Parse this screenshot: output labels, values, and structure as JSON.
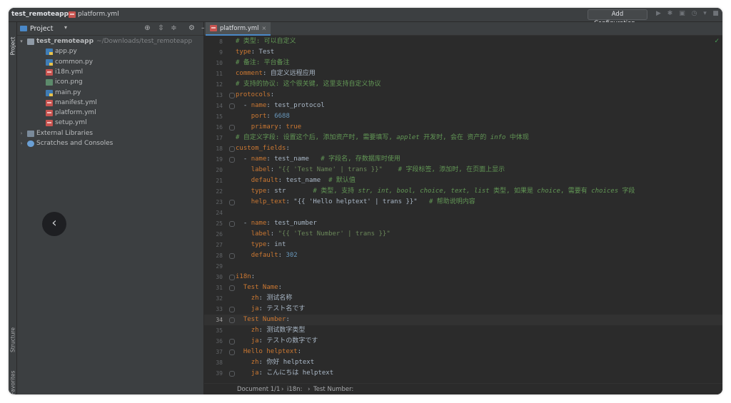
{
  "titlebar": {
    "project": "test_remoteapp",
    "file": "platform.yml",
    "run_config": "Add Configuration..."
  },
  "toolstrip": {
    "project": "Project",
    "structure": "Structure",
    "favorites": "Favorites"
  },
  "panel": {
    "title": "Project",
    "tree": [
      {
        "label": "test_remoteapp",
        "hint": "~/Downloads/test_remoteapp",
        "icon": "folder",
        "depth": 0,
        "arrow": "▾"
      },
      {
        "label": "app.py",
        "hint": "",
        "icon": "py",
        "depth": 2,
        "arrow": ""
      },
      {
        "label": "common.py",
        "hint": "",
        "icon": "py",
        "depth": 2,
        "arrow": ""
      },
      {
        "label": "i18n.yml",
        "hint": "",
        "icon": "yml",
        "depth": 2,
        "arrow": ""
      },
      {
        "label": "icon.png",
        "hint": "",
        "icon": "png",
        "depth": 2,
        "arrow": ""
      },
      {
        "label": "main.py",
        "hint": "",
        "icon": "py",
        "depth": 2,
        "arrow": ""
      },
      {
        "label": "manifest.yml",
        "hint": "",
        "icon": "yml",
        "depth": 2,
        "arrow": ""
      },
      {
        "label": "platform.yml",
        "hint": "",
        "icon": "yml",
        "depth": 2,
        "arrow": ""
      },
      {
        "label": "setup.yml",
        "hint": "",
        "icon": "yml",
        "depth": 2,
        "arrow": ""
      },
      {
        "label": "External Libraries",
        "hint": "",
        "icon": "lib",
        "depth": 0,
        "arrow": "›"
      },
      {
        "label": "Scratches and Consoles",
        "hint": "",
        "icon": "scratch",
        "depth": 0,
        "arrow": "›"
      }
    ]
  },
  "back_button": "‹",
  "editor": {
    "tab": "platform.yml",
    "current_line": 34,
    "lines": [
      {
        "n": 8,
        "t": [
          [
            "c",
            "# 类型: 可以自定义"
          ]
        ]
      },
      {
        "n": 9,
        "t": [
          [
            "k",
            "type"
          ],
          [
            "v",
            ": Test"
          ]
        ]
      },
      {
        "n": 10,
        "t": [
          [
            "c",
            "# 备注: 平台备注"
          ]
        ]
      },
      {
        "n": 11,
        "t": [
          [
            "k",
            "comment"
          ],
          [
            "v",
            ": 自定义远程应用"
          ]
        ]
      },
      {
        "n": 12,
        "t": [
          [
            "c",
            "# 支持的协议: 这个很关键, 这里支持自定义协议"
          ]
        ]
      },
      {
        "n": 13,
        "t": [
          [
            "k",
            "protocols"
          ],
          [
            "v",
            ":"
          ]
        ]
      },
      {
        "n": 14,
        "t": [
          [
            "v",
            "  - "
          ],
          [
            "k",
            "name"
          ],
          [
            "v",
            ": test_protocol"
          ]
        ]
      },
      {
        "n": 15,
        "t": [
          [
            "v",
            "    "
          ],
          [
            "k",
            "port"
          ],
          [
            "v",
            ": "
          ],
          [
            "n",
            "6688"
          ]
        ]
      },
      {
        "n": 16,
        "t": [
          [
            "v",
            "    "
          ],
          [
            "k",
            "primary"
          ],
          [
            "v",
            ": "
          ],
          [
            "k",
            "true"
          ]
        ]
      },
      {
        "n": 17,
        "t": [
          [
            "c",
            "# 自定义字段: 设置这个后, 添加资产时, 需要填写, "
          ],
          [
            "ci",
            "applet"
          ],
          [
            "c",
            " 开发时, 会在 资产的 "
          ],
          [
            "ci",
            "info"
          ],
          [
            "c",
            " 中体现"
          ]
        ]
      },
      {
        "n": 18,
        "t": [
          [
            "k",
            "custom_fields"
          ],
          [
            "v",
            ":"
          ]
        ]
      },
      {
        "n": 19,
        "t": [
          [
            "v",
            "  - "
          ],
          [
            "k",
            "name"
          ],
          [
            "v",
            ": test_name   "
          ],
          [
            "c",
            "# 字段名, 存数据库时使用"
          ]
        ]
      },
      {
        "n": 20,
        "t": [
          [
            "v",
            "    "
          ],
          [
            "k",
            "label"
          ],
          [
            "v",
            ": "
          ],
          [
            "s",
            "\"{{ 'Test Name' | trans }}\""
          ],
          [
            "v",
            "    "
          ],
          [
            "c",
            "# 字段标签, 添加时, 在页面上显示"
          ]
        ]
      },
      {
        "n": 21,
        "t": [
          [
            "v",
            "    "
          ],
          [
            "k",
            "default"
          ],
          [
            "v",
            ": test_name  "
          ],
          [
            "c",
            "# 默认值"
          ]
        ]
      },
      {
        "n": 22,
        "t": [
          [
            "v",
            "    "
          ],
          [
            "k",
            "type"
          ],
          [
            "v",
            ": str       "
          ],
          [
            "c",
            "# 类型, 支持 "
          ],
          [
            "ci",
            "str, int, bool, choice, text, list"
          ],
          [
            "c",
            " 类型, 如果是 "
          ],
          [
            "ci",
            "choice"
          ],
          [
            "c",
            ", 需要有 "
          ],
          [
            "ci",
            "choices"
          ],
          [
            "c",
            " 字段"
          ]
        ]
      },
      {
        "n": 23,
        "t": [
          [
            "v",
            "    "
          ],
          [
            "k",
            "help_text"
          ],
          [
            "v",
            ": \"{{ 'Hello helptext' | trans }}\"   "
          ],
          [
            "c",
            "# 帮助说明内容"
          ]
        ]
      },
      {
        "n": 24,
        "t": []
      },
      {
        "n": 25,
        "t": [
          [
            "v",
            "  - "
          ],
          [
            "k",
            "name"
          ],
          [
            "v",
            ": test_number"
          ]
        ]
      },
      {
        "n": 26,
        "t": [
          [
            "v",
            "    "
          ],
          [
            "k",
            "label"
          ],
          [
            "v",
            ": "
          ],
          [
            "s",
            "\"{{ 'Test Number' | trans }}\""
          ]
        ]
      },
      {
        "n": 27,
        "t": [
          [
            "v",
            "    "
          ],
          [
            "k",
            "type"
          ],
          [
            "v",
            ": int"
          ]
        ]
      },
      {
        "n": 28,
        "t": [
          [
            "v",
            "    "
          ],
          [
            "k",
            "default"
          ],
          [
            "v",
            ": "
          ],
          [
            "n",
            "302"
          ]
        ]
      },
      {
        "n": 29,
        "t": []
      },
      {
        "n": 30,
        "t": [
          [
            "k",
            "i18n"
          ],
          [
            "v",
            ":"
          ]
        ]
      },
      {
        "n": 31,
        "t": [
          [
            "v",
            "  "
          ],
          [
            "k",
            "Test Name"
          ],
          [
            "v",
            ":"
          ]
        ]
      },
      {
        "n": 32,
        "t": [
          [
            "v",
            "    "
          ],
          [
            "k",
            "zh"
          ],
          [
            "v",
            ": 测试名称"
          ]
        ]
      },
      {
        "n": 33,
        "t": [
          [
            "v",
            "    "
          ],
          [
            "k",
            "ja"
          ],
          [
            "v",
            ": テスト名です"
          ]
        ]
      },
      {
        "n": 34,
        "t": [
          [
            "v",
            "  "
          ],
          [
            "k",
            "Test Number"
          ],
          [
            "v",
            ":"
          ]
        ]
      },
      {
        "n": 35,
        "t": [
          [
            "v",
            "    "
          ],
          [
            "k",
            "zh"
          ],
          [
            "v",
            ": 测试数字类型"
          ]
        ]
      },
      {
        "n": 36,
        "t": [
          [
            "v",
            "    "
          ],
          [
            "k",
            "ja"
          ],
          [
            "v",
            ": テストの数字です"
          ]
        ]
      },
      {
        "n": 37,
        "t": [
          [
            "v",
            "  "
          ],
          [
            "k",
            "Hello helptext"
          ],
          [
            "v",
            ":"
          ]
        ]
      },
      {
        "n": 38,
        "t": [
          [
            "v",
            "    "
          ],
          [
            "k",
            "zh"
          ],
          [
            "v",
            ": 你好 helptext"
          ]
        ]
      },
      {
        "n": 39,
        "t": [
          [
            "v",
            "    "
          ],
          [
            "k",
            "ja"
          ],
          [
            "v",
            ": こんにちは helptext"
          ]
        ]
      }
    ]
  },
  "statusbar": {
    "document": "Document 1/1",
    "crumb1": "i18n:",
    "crumb2": "Test Number:"
  }
}
